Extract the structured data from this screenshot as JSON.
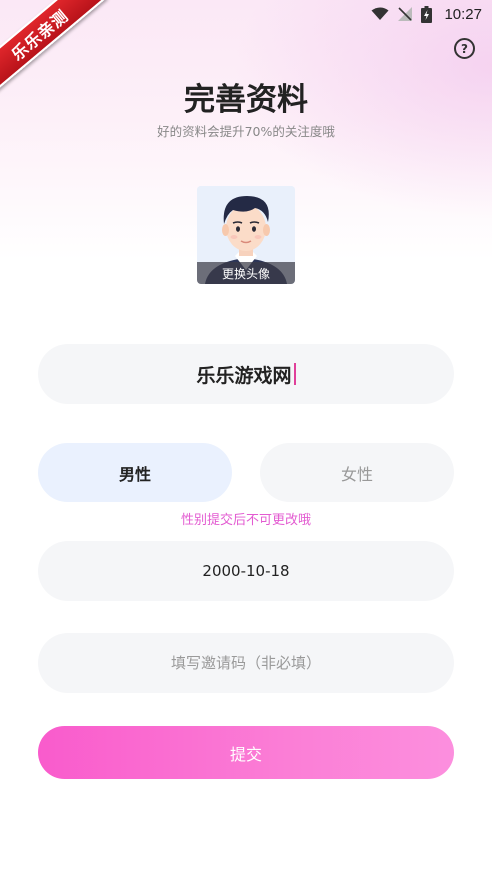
{
  "status_bar": {
    "time": "10:27",
    "icons": [
      "wifi-icon",
      "signal-off-icon",
      "battery-charging-icon"
    ]
  },
  "ribbon": {
    "label": "乐乐亲测"
  },
  "header": {
    "help_icon": "help-circle-icon",
    "help_glyph": "?",
    "title": "完善资料",
    "subtitle": "好的资料会提升70%的关注度哦"
  },
  "avatar": {
    "change_label": "更换头像"
  },
  "form": {
    "nickname": "乐乐游戏网",
    "gender": {
      "male_label": "男性",
      "female_label": "女性",
      "selected": "男性",
      "note": "性别提交后不可更改哦"
    },
    "birthday": "2000-10-18",
    "invite_placeholder": "填写邀请码（非必填）",
    "submit_label": "提交"
  },
  "colors": {
    "accent_pink": "#f95bcc",
    "note_pink": "#e35bd1",
    "selected_bg": "#eaf1fe",
    "field_bg": "#f5f6f8"
  }
}
